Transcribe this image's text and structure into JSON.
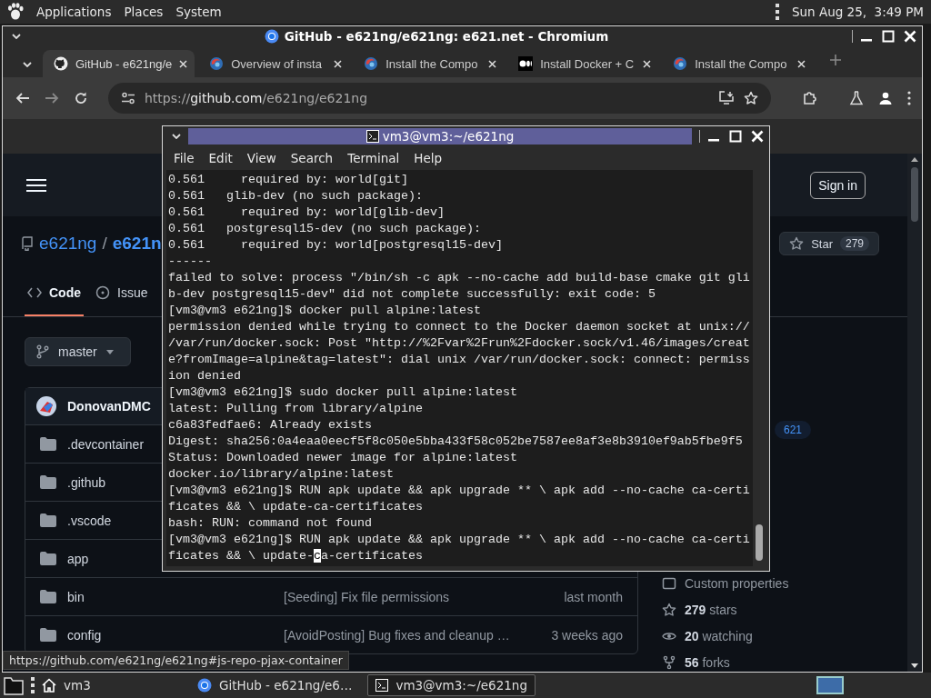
{
  "top_panel": {
    "menus": [
      "Applications",
      "Places",
      "System"
    ],
    "clock": "Sun Aug 25,  3:49 PM"
  },
  "browser": {
    "title": "GitHub - e621ng/e621ng: e621.net - Chromium",
    "tabs": [
      {
        "kind": "github",
        "label": "GitHub - e621ng/e",
        "selected": true
      },
      {
        "kind": "swirl",
        "label": "Overview of insta",
        "selected": false
      },
      {
        "kind": "swirl",
        "label": "Install the Compo",
        "selected": false
      },
      {
        "kind": "medium",
        "label": "Install Docker + C",
        "selected": false
      },
      {
        "kind": "swirl",
        "label": "Install the Compo",
        "selected": false
      }
    ],
    "url": {
      "scheme": "https://",
      "host": "github.com",
      "path": "/e621ng/e621ng"
    },
    "page": {
      "sign_in": "Sign in",
      "owner": "e621ng",
      "separator": "/",
      "repo": "e621n",
      "star_label": "Star",
      "star_count": "279",
      "repo_tabs": [
        {
          "label": "Code",
          "selected": true
        },
        {
          "label": "Issue",
          "selected": false
        }
      ],
      "branch": "master",
      "commit_author": "DonovanDMC",
      "files": [
        {
          "name": ".devcontainer"
        },
        {
          "name": ".github"
        },
        {
          "name": ".vscode"
        },
        {
          "name": "app"
        },
        {
          "name": "bin",
          "message": "[Seeding] Fix file permissions",
          "age": "last month"
        },
        {
          "name": "config",
          "message": "[AvoidPosting] Bug fixes and cleanup …",
          "age": "3 weeks ago"
        }
      ],
      "topic": "621",
      "about": [
        {
          "kind": "properties",
          "label": "Custom properties"
        },
        {
          "kind": "stars",
          "count": "279",
          "label": "stars"
        },
        {
          "kind": "watching",
          "count": "20",
          "label": "watching"
        },
        {
          "kind": "forks",
          "count": "56",
          "label": "forks"
        }
      ]
    },
    "status_url": "https://github.com/e621ng/e621ng#js-repo-pjax-container"
  },
  "terminal": {
    "title": "vm3@vm3:~/e621ng",
    "menus": [
      "File",
      "Edit",
      "View",
      "Search",
      "Terminal",
      "Help"
    ],
    "lines": [
      "0.561     required by: world[git]",
      "0.561   glib-dev (no such package):",
      "0.561     required by: world[glib-dev]",
      "0.561   postgresql15-dev (no such package):",
      "0.561     required by: world[postgresql15-dev]",
      "------",
      "failed to solve: process \"/bin/sh -c apk --no-cache add build-base cmake git gli",
      "b-dev postgresql15-dev\" did not complete successfully: exit code: 5",
      "[vm3@vm3 e621ng]$ docker pull alpine:latest",
      "permission denied while trying to connect to the Docker daemon socket at unix://",
      "/var/run/docker.sock: Post \"http://%2Fvar%2Frun%2Fdocker.sock/v1.46/images/creat",
      "e?fromImage=alpine&tag=latest\": dial unix /var/run/docker.sock: connect: permiss",
      "ion denied",
      "[vm3@vm3 e621ng]$ sudo docker pull alpine:latest",
      "latest: Pulling from library/alpine",
      "c6a83fedfae6: Already exists",
      "Digest: sha256:0a4eaa0eecf5f8c050e5bba433f58c052be7587ee8af3e8b3910ef9ab5fbe9f5",
      "Status: Downloaded newer image for alpine:latest",
      "docker.io/library/alpine:latest",
      "[vm3@vm3 e621ng]$ RUN apk update && apk upgrade ** \\ apk add --no-cache ca-certi",
      "ficates && \\ update-ca-certificates",
      "bash: RUN: command not found",
      "[vm3@vm3 e621ng]$ RUN apk update && apk upgrade ** \\ apk add --no-cache ca-certi"
    ],
    "cursor_line": {
      "before": "ficates && \\ update-",
      "at": "c",
      "after": "a-certificates"
    }
  },
  "taskbar": {
    "workspace_label": "vm3",
    "tasks": [
      {
        "kind": "browser",
        "label": "GitHub - e621ng/e6…",
        "selected": false
      },
      {
        "kind": "terminal",
        "label": "vm3@vm3:~/e621ng",
        "selected": true
      }
    ]
  }
}
